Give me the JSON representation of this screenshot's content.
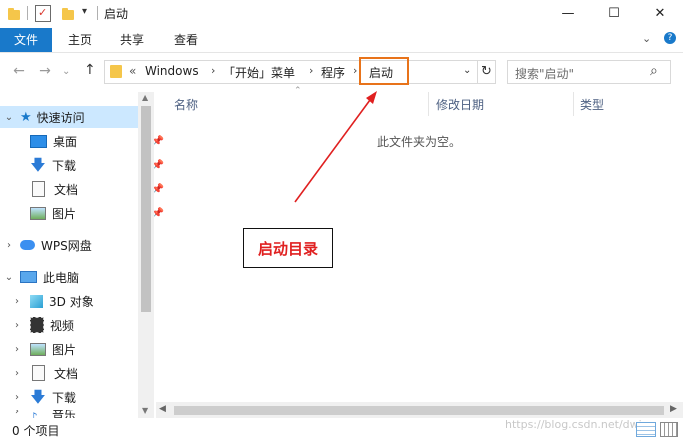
{
  "window": {
    "title": "启动",
    "minimize_glyph": "—",
    "maximize_glyph": "☐",
    "close_glyph": "✕"
  },
  "ribbon": {
    "tabs": [
      {
        "label": "文件",
        "active": true
      },
      {
        "label": "主页",
        "active": false
      },
      {
        "label": "共享",
        "active": false
      },
      {
        "label": "查看",
        "active": false
      }
    ]
  },
  "address": {
    "overflow": "«",
    "crumbs": [
      "Windows",
      "「开始」菜单",
      "程序",
      "启动"
    ]
  },
  "search": {
    "placeholder": "搜索\"启动\""
  },
  "nav": {
    "quick_access": "快速访问",
    "quick_items": [
      "桌面",
      "下载",
      "文档",
      "图片"
    ],
    "wps": "WPS网盘",
    "this_pc": "此电脑",
    "pc_items": [
      "3D 对象",
      "视频",
      "图片",
      "文档",
      "下载",
      "音乐"
    ]
  },
  "content": {
    "columns": [
      "名称",
      "修改日期",
      "类型"
    ],
    "empty_message": "此文件夹为空。"
  },
  "annotation": {
    "label": "启动目录",
    "color": "#e02020"
  },
  "status": {
    "count": "0 个项目"
  },
  "watermark": "https://blog.csdn.net/dwjp"
}
